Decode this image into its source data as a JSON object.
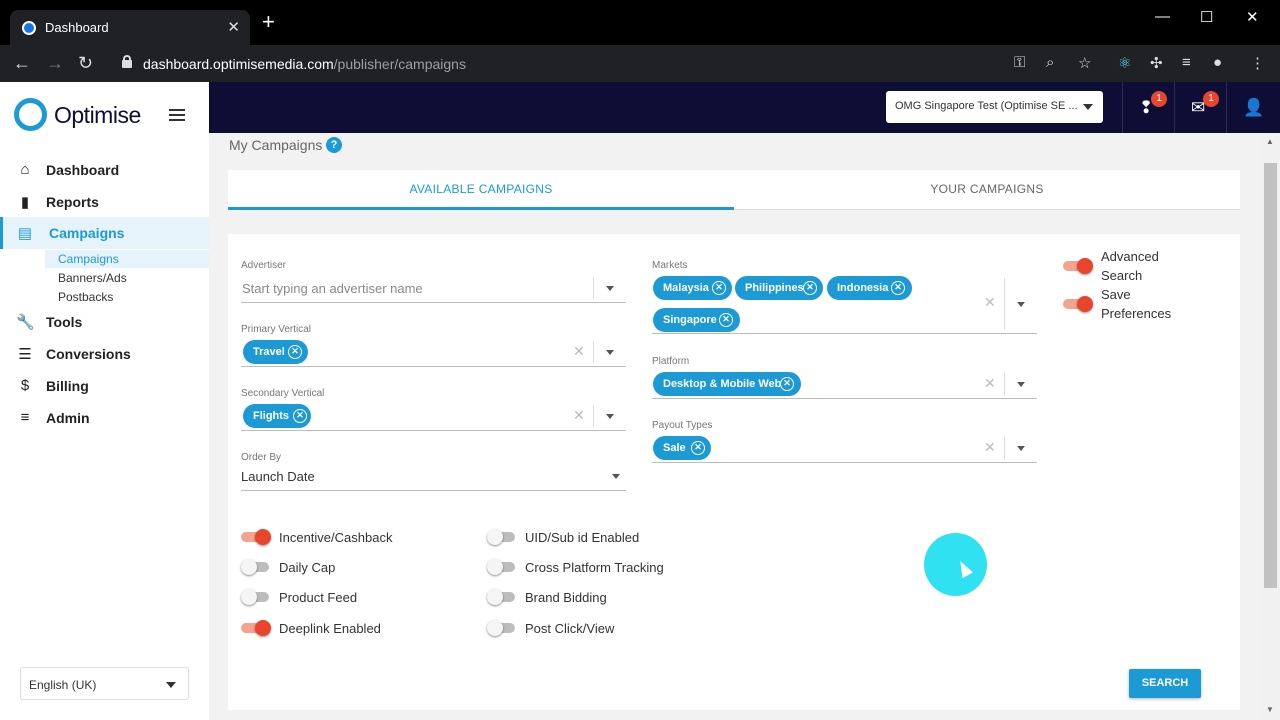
{
  "browser": {
    "tab_title": "Dashboard",
    "tab_close": "✕",
    "new_tab": "+",
    "url_host": "dashboard.optimisemedia.com",
    "url_path": "/publisher/campaigns"
  },
  "header": {
    "account": "OMG Singapore Test (Optimise SE ...",
    "notifications_count": "1",
    "messages_count": "1"
  },
  "logo": {
    "text": "Optimise"
  },
  "sidebar": {
    "items": [
      {
        "label": "Dashboard",
        "icon": "home-icon"
      },
      {
        "label": "Reports",
        "icon": "bar-chart-icon"
      },
      {
        "label": "Campaigns",
        "icon": "store-icon"
      },
      {
        "label": "Tools",
        "icon": "wrench-icon"
      },
      {
        "label": "Conversions",
        "icon": "list-icon"
      },
      {
        "label": "Billing",
        "icon": "dollar-icon"
      },
      {
        "label": "Admin",
        "icon": "lines-icon"
      }
    ],
    "sub_items": [
      "Campaigns",
      "Banners/Ads",
      "Postbacks"
    ],
    "language": "English (UK)"
  },
  "page": {
    "title": "My Campaigns",
    "help": "?",
    "tabs": [
      "AVAILABLE CAMPAIGNS",
      "YOUR CAMPAIGNS"
    ]
  },
  "filters": {
    "advertiser_label": "Advertiser",
    "advertiser_placeholder": "Start typing an advertiser name",
    "primary_vertical_label": "Primary Vertical",
    "primary_vertical_chips": [
      "Travel"
    ],
    "secondary_vertical_label": "Secondary Vertical",
    "secondary_vertical_chips": [
      "Flights"
    ],
    "order_by_label": "Order By",
    "order_by_value": "Launch Date",
    "markets_label": "Markets",
    "markets_chips": [
      "Malaysia",
      "Philippines",
      "Indonesia",
      "Singapore"
    ],
    "platform_label": "Platform",
    "platform_chips": [
      "Desktop & Mobile Web"
    ],
    "payout_label": "Payout Types",
    "payout_chips": [
      "Sale"
    ],
    "clear": "✕",
    "chip_remove": "✕"
  },
  "prefs": {
    "advanced_search_line1": "Advanced",
    "advanced_search_line2": "Search",
    "save_preferences_line1": "Save",
    "save_preferences_line2": "Preferences"
  },
  "toggles": {
    "incentive": "Incentive/Cashback",
    "daily_cap": "Daily Cap",
    "product_feed": "Product Feed",
    "deeplink": "Deeplink Enabled",
    "uid": "UID/Sub id Enabled",
    "cross_platform": "Cross Platform Tracking",
    "brand_bidding": "Brand Bidding",
    "post_click": "Post Click/View"
  },
  "actions": {
    "search": "SEARCH"
  },
  "colors": {
    "accent": "#1c9ad6",
    "toggle_on": "#e8452c",
    "header_bg": "#0d0d35"
  }
}
